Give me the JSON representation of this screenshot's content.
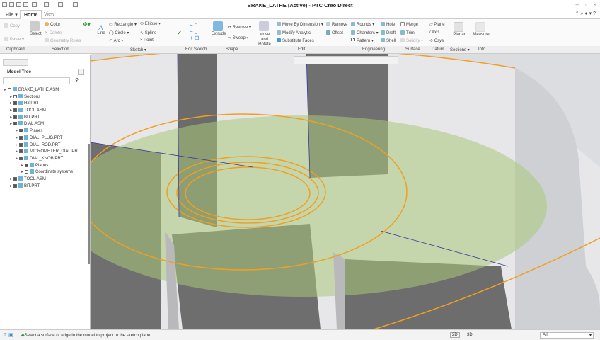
{
  "window": {
    "title": "BRAKE_LATHE (Active) - PTC Creo Direct"
  },
  "tabs": [
    {
      "label": "File"
    },
    {
      "label": "Home"
    },
    {
      "label": "View"
    }
  ],
  "ribbon": {
    "clipboard": {
      "copy": "Copy",
      "paste": "Paste",
      "label": "Clipboard"
    },
    "selection": {
      "select": "Select",
      "color": "Color",
      "delete": "Delete",
      "geometry_rules": "Geometry Rules",
      "label": "Selection"
    },
    "sketch": {
      "line": "Line",
      "rectangle": "Rectangle",
      "circle": "Circle",
      "arc": "Arc",
      "ellipse": "Ellipse",
      "spline": "Spline",
      "point": "Point",
      "label": "Sketch"
    },
    "edit_sketch": {
      "label": "Edit Sketch"
    },
    "shape": {
      "extrude": "Extrude",
      "revolve": "Revolve",
      "sweep": "Sweep",
      "label": "Shape"
    },
    "edit": {
      "move_rotate": "Move and Rotate",
      "move_by_dimension": "Move By Dimension",
      "modify_analytic": "Modify Analytic",
      "substitute_faces": "Substitute Faces",
      "remove": "Remove",
      "offset": "Offset",
      "label": "Edit"
    },
    "engineering": {
      "rounds": "Rounds",
      "chamfers": "Chamfers",
      "pattern": "Pattern",
      "hole": "Hole",
      "draft": "Draft",
      "shell": "Shell",
      "label": "Engineering"
    },
    "surface": {
      "merge": "Merge",
      "trim": "Trim",
      "solidify": "Solidify",
      "label": "Surface"
    },
    "datum": {
      "plane": "Plane",
      "axis": "Axis",
      "csys": "Csys",
      "label": "Datum"
    },
    "sections": {
      "planar": "Planar",
      "label": "Sections"
    },
    "info": {
      "measure": "Measure",
      "label": "Info"
    }
  },
  "model_tree": {
    "title": "Model Tree",
    "search_placeholder": "",
    "items": [
      {
        "label": "BRAKE_LATHE.ASM",
        "level": 0,
        "checked": false
      },
      {
        "label": "Sections",
        "level": 1,
        "checked": false
      },
      {
        "label": "H2.PRT",
        "level": 1,
        "checked": true
      },
      {
        "label": "TOOL.ASM",
        "level": 1,
        "checked": true
      },
      {
        "label": "BIT.PRT",
        "level": 1,
        "checked": true
      },
      {
        "label": "DIAL.ASM",
        "level": 1,
        "checked": true
      },
      {
        "label": "Planes",
        "level": 2,
        "checked": true
      },
      {
        "label": "DIAL_PLUG.PRT",
        "level": 2,
        "checked": true
      },
      {
        "label": "DIAL_ROD.PRT",
        "level": 2,
        "checked": true
      },
      {
        "label": "MICROMETER_DIAL.PRT",
        "level": 2,
        "checked": true
      },
      {
        "label": "DIAL_KNOB.PRT",
        "level": 2,
        "checked": true
      },
      {
        "label": "Planes",
        "level": 3,
        "checked": true
      },
      {
        "label": "Coordinate systems",
        "level": 3,
        "checked": false
      },
      {
        "label": "TOOL.ASM",
        "level": 1,
        "checked": true
      },
      {
        "label": "BIT.PRT",
        "level": 1,
        "checked": true
      }
    ]
  },
  "status": {
    "message": "Select a surface or edge in the model to project to the sketch plane",
    "mode_2d": "2D",
    "mode_3d": "3D",
    "filter": "All"
  },
  "colors": {
    "sketch_orange": "#f0a020",
    "plane_green": "#a9c97a",
    "solid_dark": "#6e6e6e"
  }
}
